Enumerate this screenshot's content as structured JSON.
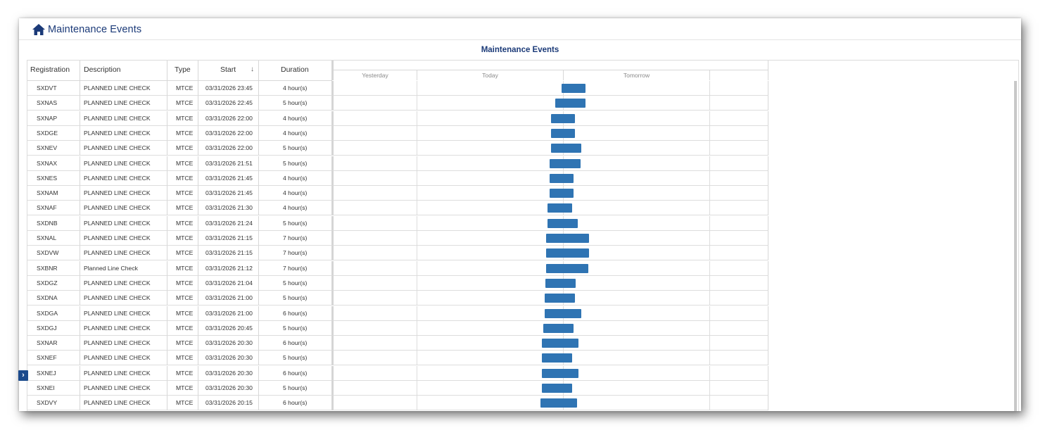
{
  "app": {
    "title": "Maintenance Events",
    "icon": "home-icon"
  },
  "panel": {
    "title": "Maintenance Events"
  },
  "columns": {
    "registration": "Registration",
    "description": "Description",
    "type": "Type",
    "start": "Start",
    "duration": "Duration"
  },
  "sort_icon": "↓",
  "gantt": {
    "days": [
      "Yesterday",
      "Today",
      "Tomorrow"
    ]
  },
  "bar_color": "#2f74b3",
  "accent_color": "#1b3a78",
  "rows": [
    {
      "registration": "SXDVT",
      "description": "PLANNED LINE CHECK",
      "type": "MTCE",
      "start": "03/31/2026 23:45",
      "duration": "4 hour(s)",
      "start_hour": 23.75,
      "hours": 4
    },
    {
      "registration": "SXNAS",
      "description": "PLANNED LINE CHECK",
      "type": "MTCE",
      "start": "03/31/2026 22:45",
      "duration": "5 hour(s)",
      "start_hour": 22.75,
      "hours": 5
    },
    {
      "registration": "SXNAP",
      "description": "PLANNED LINE CHECK",
      "type": "MTCE",
      "start": "03/31/2026 22:00",
      "duration": "4 hour(s)",
      "start_hour": 22.0,
      "hours": 4
    },
    {
      "registration": "SXDGE",
      "description": "PLANNED LINE CHECK",
      "type": "MTCE",
      "start": "03/31/2026 22:00",
      "duration": "4 hour(s)",
      "start_hour": 22.0,
      "hours": 4
    },
    {
      "registration": "SXNEV",
      "description": "PLANNED LINE CHECK",
      "type": "MTCE",
      "start": "03/31/2026 22:00",
      "duration": "5 hour(s)",
      "start_hour": 22.0,
      "hours": 5
    },
    {
      "registration": "SXNAX",
      "description": "PLANNED LINE CHECK",
      "type": "MTCE",
      "start": "03/31/2026 21:51",
      "duration": "5 hour(s)",
      "start_hour": 21.85,
      "hours": 5
    },
    {
      "registration": "SXNES",
      "description": "PLANNED LINE CHECK",
      "type": "MTCE",
      "start": "03/31/2026 21:45",
      "duration": "4 hour(s)",
      "start_hour": 21.75,
      "hours": 4
    },
    {
      "registration": "SXNAM",
      "description": "PLANNED LINE CHECK",
      "type": "MTCE",
      "start": "03/31/2026 21:45",
      "duration": "4 hour(s)",
      "start_hour": 21.75,
      "hours": 4
    },
    {
      "registration": "SXNAF",
      "description": "PLANNED LINE CHECK",
      "type": "MTCE",
      "start": "03/31/2026 21:30",
      "duration": "4 hour(s)",
      "start_hour": 21.5,
      "hours": 4
    },
    {
      "registration": "SXDNB",
      "description": "PLANNED LINE CHECK",
      "type": "MTCE",
      "start": "03/31/2026 21:24",
      "duration": "5 hour(s)",
      "start_hour": 21.4,
      "hours": 5
    },
    {
      "registration": "SXNAL",
      "description": "PLANNED LINE CHECK",
      "type": "MTCE",
      "start": "03/31/2026 21:15",
      "duration": "7 hour(s)",
      "start_hour": 21.25,
      "hours": 7
    },
    {
      "registration": "SXDVW",
      "description": "PLANNED LINE CHECK",
      "type": "MTCE",
      "start": "03/31/2026 21:15",
      "duration": "7 hour(s)",
      "start_hour": 21.25,
      "hours": 7
    },
    {
      "registration": "SXBNR",
      "description": "Planned Line Check",
      "type": "MTCE",
      "start": "03/31/2026 21:12",
      "duration": "7 hour(s)",
      "start_hour": 21.2,
      "hours": 7
    },
    {
      "registration": "SXDGZ",
      "description": "PLANNED LINE CHECK",
      "type": "MTCE",
      "start": "03/31/2026 21:04",
      "duration": "5 hour(s)",
      "start_hour": 21.07,
      "hours": 5
    },
    {
      "registration": "SXDNA",
      "description": "PLANNED LINE CHECK",
      "type": "MTCE",
      "start": "03/31/2026 21:00",
      "duration": "5 hour(s)",
      "start_hour": 21.0,
      "hours": 5
    },
    {
      "registration": "SXDGA",
      "description": "PLANNED LINE CHECK",
      "type": "MTCE",
      "start": "03/31/2026 21:00",
      "duration": "6 hour(s)",
      "start_hour": 21.0,
      "hours": 6
    },
    {
      "registration": "SXDGJ",
      "description": "PLANNED LINE CHECK",
      "type": "MTCE",
      "start": "03/31/2026 20:45",
      "duration": "5 hour(s)",
      "start_hour": 20.75,
      "hours": 5
    },
    {
      "registration": "SXNAR",
      "description": "PLANNED LINE CHECK",
      "type": "MTCE",
      "start": "03/31/2026 20:30",
      "duration": "6 hour(s)",
      "start_hour": 20.5,
      "hours": 6
    },
    {
      "registration": "SXNEF",
      "description": "PLANNED LINE CHECK",
      "type": "MTCE",
      "start": "03/31/2026 20:30",
      "duration": "5 hour(s)",
      "start_hour": 20.5,
      "hours": 5
    },
    {
      "registration": "SXNEJ",
      "description": "PLANNED LINE CHECK",
      "type": "MTCE",
      "start": "03/31/2026 20:30",
      "duration": "6 hour(s)",
      "start_hour": 20.5,
      "hours": 6
    },
    {
      "registration": "SXNEI",
      "description": "PLANNED LINE CHECK",
      "type": "MTCE",
      "start": "03/31/2026 20:30",
      "duration": "5 hour(s)",
      "start_hour": 20.5,
      "hours": 5
    },
    {
      "registration": "SXDVY",
      "description": "PLANNED LINE CHECK",
      "type": "MTCE",
      "start": "03/31/2026 20:15",
      "duration": "6 hour(s)",
      "start_hour": 20.25,
      "hours": 6
    }
  ]
}
